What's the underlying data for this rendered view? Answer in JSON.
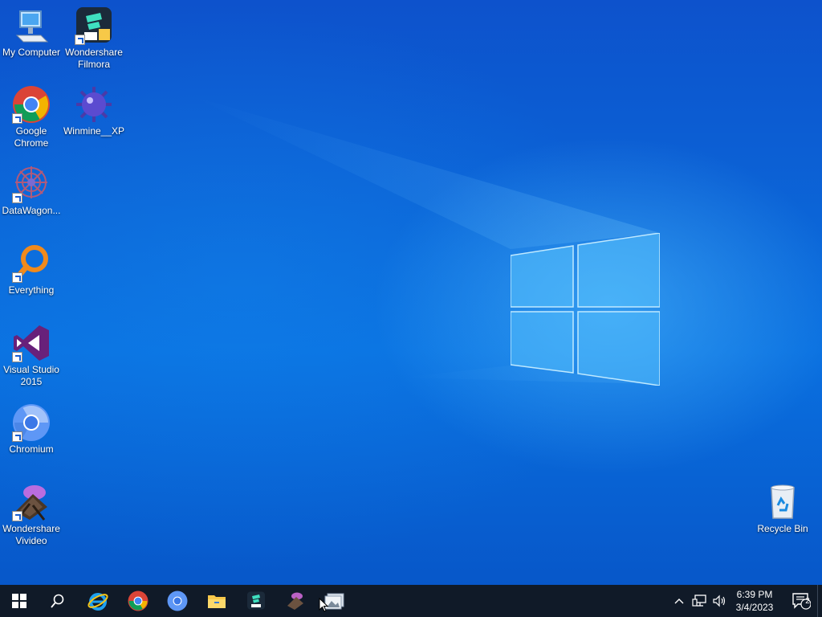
{
  "desktop": {
    "icons": [
      {
        "label": "My Computer",
        "icon": "computer-icon"
      },
      {
        "label": "Wondershare Filmora",
        "icon": "filmora-icon"
      },
      {
        "label": "Google Chrome",
        "icon": "chrome-icon"
      },
      {
        "label": "Winmine__XP",
        "icon": "mine-icon"
      },
      {
        "label": "DataWagon...",
        "icon": "datawagon-icon"
      },
      {
        "label": "Everything",
        "icon": "everything-search-icon"
      },
      {
        "label": "Visual Studio 2015",
        "icon": "visual-studio-icon"
      },
      {
        "label": "Chromium",
        "icon": "chromium-icon"
      },
      {
        "label": "Wondershare Vivideo",
        "icon": "vivideo-icon"
      },
      {
        "label": "Recycle Bin",
        "icon": "recycle-bin-icon"
      }
    ]
  },
  "taskbar": {
    "pinned": [
      "start-icon",
      "search-icon",
      "internet-explorer-icon",
      "chrome-icon",
      "chromium-icon",
      "file-explorer-icon",
      "filmora-icon",
      "vivideo-icon",
      "photos-icon"
    ],
    "clock": {
      "time": "6:39 PM",
      "date": "3/4/2023"
    },
    "notifications": {
      "count": "2"
    }
  },
  "colors": {
    "taskbar": "#101a28",
    "wallpaper": "#0a63d4",
    "accent": "#1a73e8"
  }
}
